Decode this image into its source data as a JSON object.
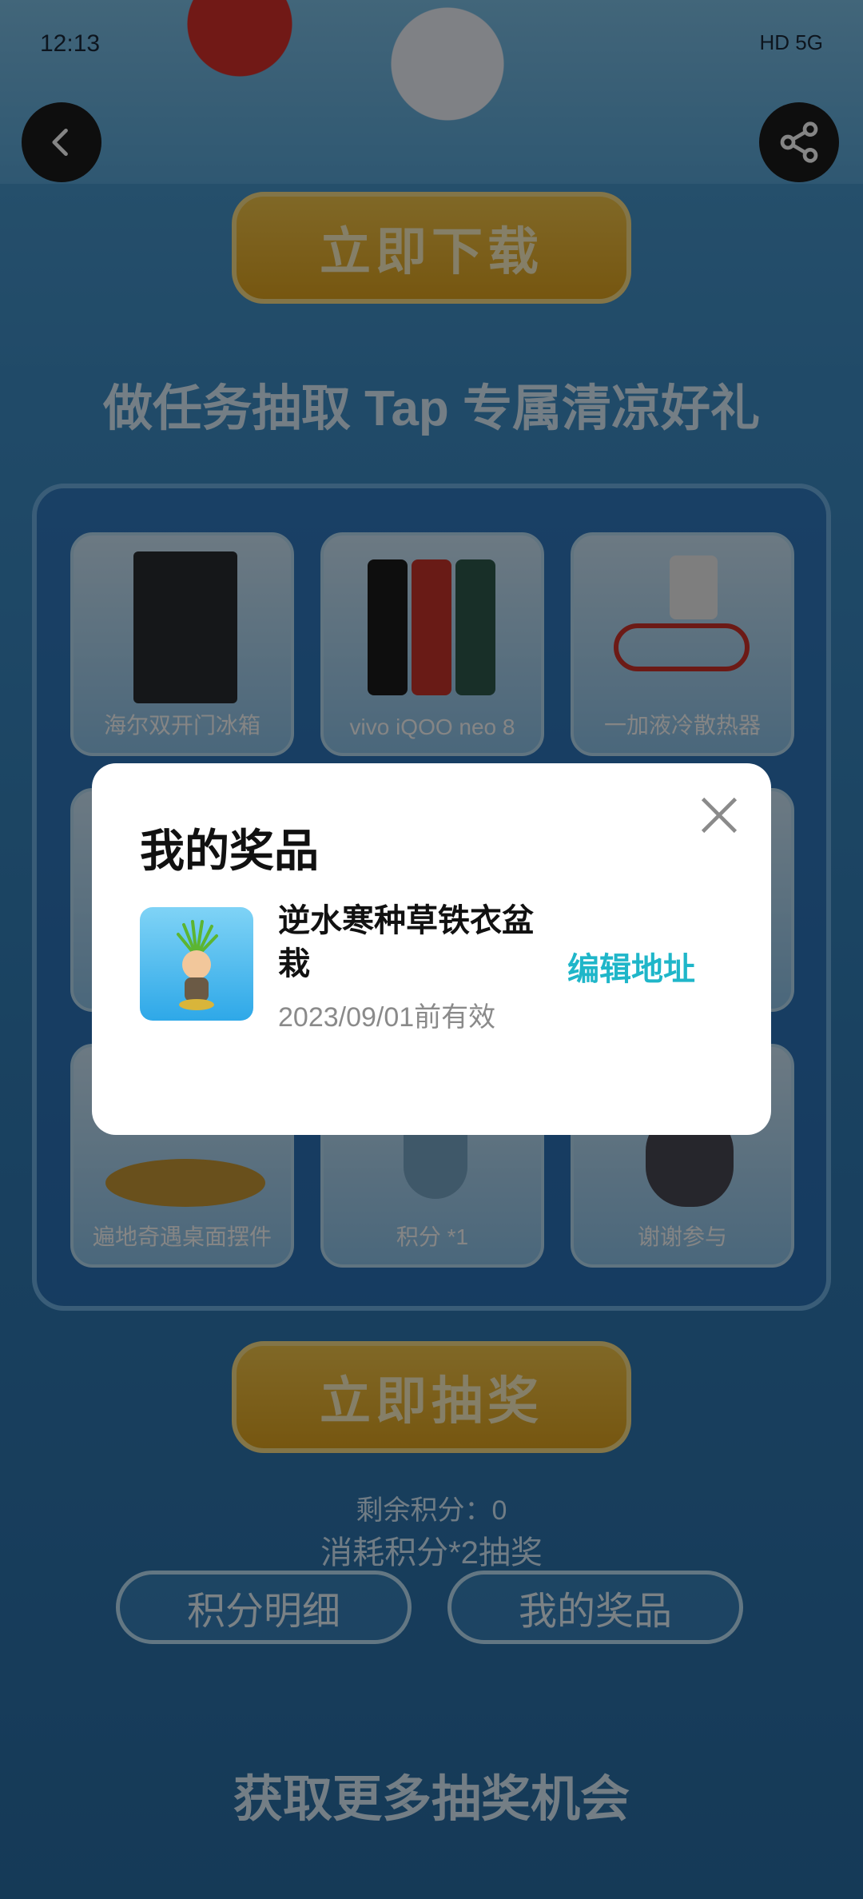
{
  "status_bar": {
    "time": "12:13",
    "right_text": "HD 5G"
  },
  "top": {
    "back_icon": "chevron-left-icon",
    "share_icon": "share-icon",
    "download_button": "立即下载"
  },
  "tasks_section": {
    "title": "做任务抽取 Tap 专属清凉好礼",
    "prizes": [
      {
        "label": "海尔双开门冰箱"
      },
      {
        "label": "vivo iQOO neo 8"
      },
      {
        "label": "一加液冷散热器"
      },
      {
        "label": "遍地奇遇桌面摆件"
      },
      {
        "label": "积分 *1"
      },
      {
        "label": "谢谢参与"
      }
    ],
    "draw_button": "立即抽奖",
    "remaining_points": "剩余积分：0",
    "cost_text": "消耗积分*2抽奖",
    "points_detail_button": "积分明细",
    "my_prizes_button": "我的奖品"
  },
  "more_section": {
    "title": "获取更多抽奖机会"
  },
  "dialog": {
    "title": "我的奖品",
    "close_icon": "close-icon",
    "item": {
      "name": "逆水寒种草铁衣盆栽",
      "expiry": "2023/09/01前有效",
      "action": "编辑地址"
    }
  },
  "colors": {
    "accent": "#1fb6c9",
    "dialog_bg": "#ffffff",
    "download_yellow": "#e3a620"
  }
}
